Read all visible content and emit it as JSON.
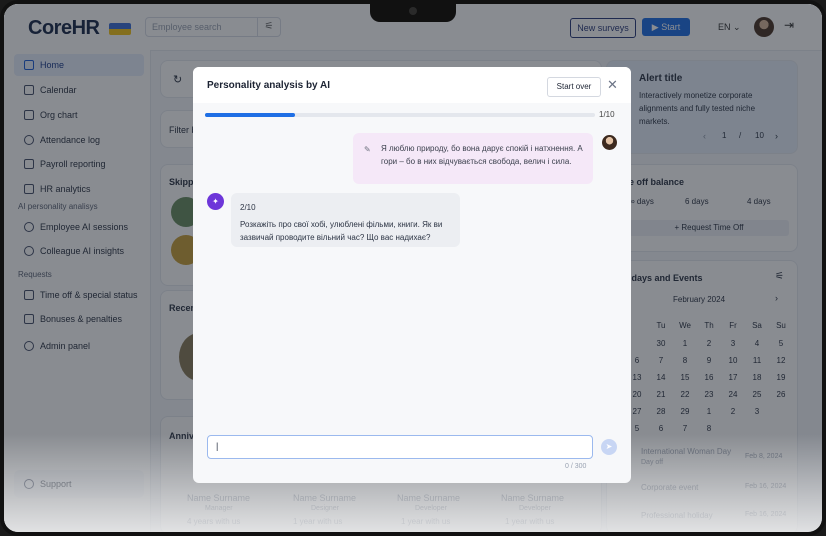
{
  "app": {
    "logo": "CoreHR",
    "flag_colors": [
      "#3c6fd6",
      "#f5c518"
    ]
  },
  "topbar": {
    "search_placeholder": "Employee search",
    "new_surveys": "New surveys",
    "start": "Start",
    "lang": "EN"
  },
  "sidebar": {
    "items": [
      {
        "label": "Home",
        "icon": "home-icon"
      },
      {
        "label": "Calendar",
        "icon": "calendar-icon"
      },
      {
        "label": "Org chart",
        "icon": "org-chart-icon"
      },
      {
        "label": "Attendance log",
        "icon": "clock-icon"
      },
      {
        "label": "Payroll reporting",
        "icon": "document-icon"
      },
      {
        "label": "HR analytics",
        "icon": "chart-icon"
      }
    ],
    "section_ai": "AI personality analisys",
    "ai_items": [
      {
        "label": "Employee AI sessions",
        "icon": "sparkle-icon"
      },
      {
        "label": "Colleague AI insights",
        "icon": "people-icon"
      }
    ],
    "section_requests": "Requests",
    "request_items": [
      {
        "label": "Time off & special status",
        "icon": "list-icon"
      },
      {
        "label": "Bonuses & penalties",
        "icon": "box-icon"
      }
    ],
    "admin": "Admin panel",
    "support": "Support"
  },
  "background": {
    "filter": "Filter b",
    "skip": "Skipp",
    "recent": "Recen",
    "anniv": "Anniv",
    "alert_title": "Alert title",
    "alert_text": "Interactively monetize corporate alignments and fully tested niche markets.",
    "pager": {
      "current": "1",
      "sep": "/",
      "total": "10"
    },
    "balance_title": "e off balance",
    "balance_items": [
      "∞ days",
      "6 days",
      "4 days"
    ],
    "request_time_off": "+ Request Time Off",
    "holidays_title": "idays and Events",
    "month": "February 2024",
    "weekdays": [
      "Tu",
      "We",
      "Th",
      "Fr",
      "Sa",
      "Su"
    ],
    "weeks": [
      [
        "30",
        "1",
        "2",
        "3",
        "4",
        "5"
      ],
      [
        "6",
        "7",
        "8",
        "9",
        "10",
        "11",
        "12"
      ],
      [
        "13",
        "14",
        "15",
        "16",
        "17",
        "18",
        "19"
      ],
      [
        "20",
        "21",
        "22",
        "23",
        "24",
        "25",
        "26"
      ],
      [
        "27",
        "28",
        "29",
        "1",
        "2",
        "3"
      ],
      [
        "5",
        "6",
        "7",
        "8"
      ]
    ],
    "events": [
      {
        "name": "International Woman Day",
        "sub": "Day off",
        "date": "Feb 8, 2024"
      },
      {
        "name": "Corporate event",
        "date": "Feb 16, 2024"
      },
      {
        "name": "Professional holiday",
        "date": "Feb 16, 2024"
      }
    ],
    "people": [
      {
        "name": "Name Surname",
        "role": "Manager",
        "tenure": "4 years with us"
      },
      {
        "name": "Name Surname",
        "role": "Designer",
        "tenure": "1 year with us"
      },
      {
        "name": "Name Surname",
        "role": "Developer",
        "tenure": "1 year with us"
      },
      {
        "name": "Name Surname",
        "role": "Developer",
        "tenure": "1 year with us"
      }
    ]
  },
  "modal": {
    "title": "Personality analysis by AI",
    "start_over": "Start over",
    "progress_label": "1/10",
    "progress": 0.23,
    "user_message": "Я люблю природу, бо вона дарує спокій і натхнення. А гори – бо в них відчувається свобода, велич і сила.",
    "ai_step": "2/10",
    "ai_message": "Розкажіть про свої хобі, улюблені фільми, книги. Як ви зазвичай проводите вільний час? Що вас надихає?",
    "input_value": "|",
    "counter": "0 / 300"
  }
}
